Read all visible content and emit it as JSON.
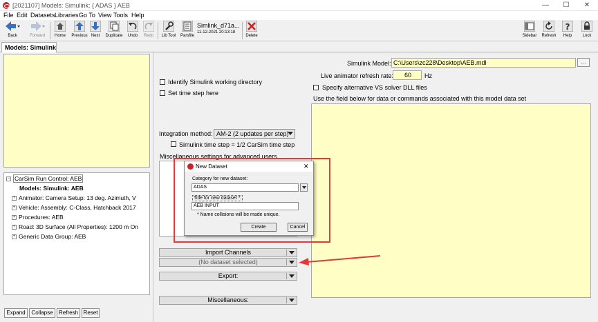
{
  "window": {
    "title": "[2021107] Models: Simulink; { ADAS } AEB",
    "minimize": "—",
    "maximize": "☐",
    "close": "✕"
  },
  "menu": [
    "File",
    "Edit",
    "Datasets",
    "Libraries",
    "Go To",
    "View",
    "Tools",
    "Help"
  ],
  "toolbar": {
    "back": "Back",
    "forward": "Forward",
    "home": "Home",
    "previous": "Previous",
    "next": "Next",
    "duplicate": "Duplicate",
    "undo": "Undo",
    "redo": "Redo",
    "lib_tool": "Lib Tool",
    "parsfile": "Parsfile",
    "parsfile_name": "Simlink_d71a...",
    "parsfile_date": "11-12-2021 20:13:18",
    "delete": "Delete",
    "sidebar": "Sidebar",
    "refresh": "Refresh",
    "help": "Help",
    "lock": "Lock"
  },
  "tab": {
    "label": "Models: Simulink"
  },
  "tree": {
    "root": "CarSim Run Control: AEB",
    "current": "Models: Simulink: AEB",
    "items": [
      "Animator: Camera Setup: 13 deg. Azimuth, V",
      "Vehicle: Assembly: C-Class, Hatchback 2017",
      "Procedures: AEB",
      "Road: 3D Surface (All Properties): 1200 m On",
      "Generic Data Group: AEB"
    ]
  },
  "left_buttons": {
    "expand": "Expand",
    "collapse": "Collapse",
    "refresh": "Refresh",
    "reset": "Reset"
  },
  "center": {
    "identify_wd": "Identify Simulink working directory",
    "set_time_step": "Set time step here",
    "integration_label": "Integration method:",
    "integration_value": "AM-2 (2 updates per step)",
    "simulink_time_step": "Simulink time step = 1/2 CarSim time step",
    "misc_settings": "Miscellaneous settings for advanced users",
    "import_channels": "Import Channels",
    "no_dataset": "(No dataset selected)",
    "export": "Export:",
    "miscellaneous": "Miscellaneous:"
  },
  "right": {
    "model_label": "Simulink Model:",
    "model_path": "C:\\Users\\zc228\\Desktop\\AEB.mdl",
    "browse": "...",
    "refresh_rate_label": "Live animator refresh rate:",
    "refresh_rate_value": "60",
    "refresh_rate_unit": "Hz",
    "alt_solver": "Specify alternative VS solver DLL files",
    "field_hint": "Use the field below  for data or commands associated with this model data set"
  },
  "dialog": {
    "title": "New Dataset",
    "category_label": "Category for new dataset:",
    "category_value": "ADAS",
    "title_label": "Title for new dataset *:",
    "title_value": "AEB INPUT",
    "note": "* Name collisions will be made unique.",
    "create": "Create",
    "cancel": "Cancel",
    "close": "✕"
  },
  "colors": {
    "yellow_field": "#ffffc5",
    "annotation_red": "#e53935",
    "app_icon_red": "#c0282d"
  }
}
